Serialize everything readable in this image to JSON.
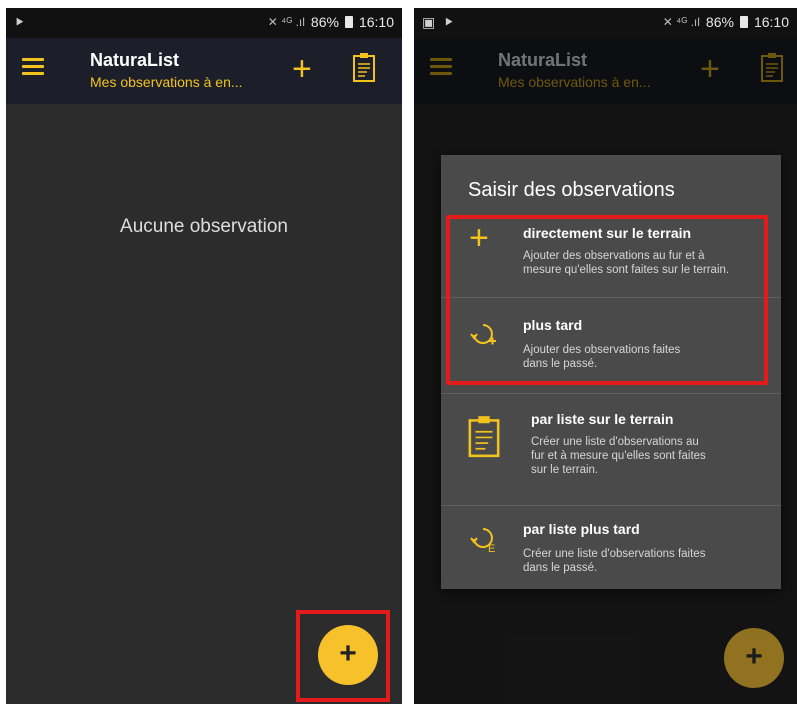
{
  "status": {
    "time": "16:10",
    "battery": "86%"
  },
  "app": {
    "title": "NaturaList",
    "subtitle": "Mes observations à en..."
  },
  "empty_state": {
    "text": "Aucune observation"
  },
  "fab": {
    "label": "+"
  },
  "dialog": {
    "title": "Saisir des observations",
    "options": [
      {
        "title": "directement sur le terrain",
        "desc": "Ajouter des observations au fur et à\nmesure qu'elles sont faites sur le terrain.",
        "icon": "plus-icon"
      },
      {
        "title": "plus tard",
        "desc": "Ajouter des observations faites\ndans le passé.",
        "icon": "history-add-icon"
      },
      {
        "title": "par liste sur le terrain",
        "desc": "Créer une liste d'observations au\nfur et à mesure qu'elles sont faites\nsur le terrain.",
        "icon": "clipboard-icon"
      },
      {
        "title": "par liste plus tard",
        "desc": "Créer une liste d'observations faites\ndans le passé.",
        "icon": "history-list-icon"
      }
    ]
  },
  "colors": {
    "accent": "#f2c21d",
    "highlight": "#e31b1b",
    "background": "#2c2c2c",
    "appbar": "#1c1f29"
  }
}
